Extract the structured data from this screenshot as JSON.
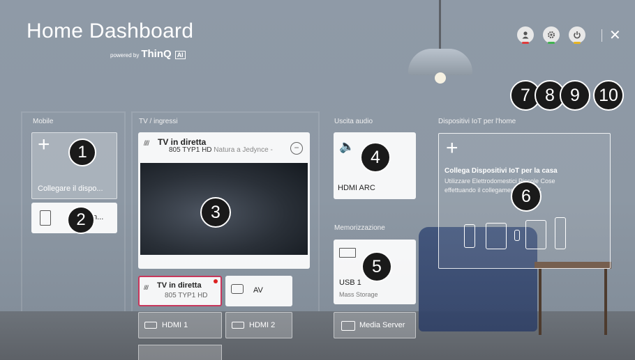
{
  "header": {
    "title": "Home Dashboard",
    "powered_by": "powered by",
    "brand": "ThinQ",
    "brand_badge": "AI"
  },
  "top_actions": [
    {
      "icon": "user-icon",
      "accent": "#e03c3c"
    },
    {
      "icon": "settings-icon",
      "accent": "#3fb34f"
    },
    {
      "icon": "power-icon",
      "accent": "#e6b422"
    },
    {
      "icon": "close-icon",
      "glyph": "✕"
    }
  ],
  "callouts": [
    "1",
    "2",
    "3",
    "4",
    "5",
    "6",
    "7",
    "8",
    "9",
    "10"
  ],
  "sections": {
    "mobile": "Mobile",
    "tv_inputs": "TV / ingressi",
    "audio_out": "Uscita audio",
    "storage": "Memorizzazione",
    "iot": "Dispositivi IoT per l'home"
  },
  "mobile_card": {
    "plus": "+",
    "label": "Collegare il dispo..."
  },
  "home_speaker_card": {
    "label": "n..."
  },
  "tv_card": {
    "antenna_glyph": "////",
    "channel_name": "TV in diretta",
    "channel_number": "805 TYP1 HD",
    "program": "Natura a Jedynce -",
    "minus": "−"
  },
  "tv_live_card": {
    "name": "TV in diretta",
    "number": "805 TYP1 HD"
  },
  "av_card": {
    "label": "AV"
  },
  "hdmi1": {
    "label": "HDMI 1"
  },
  "hdmi2": {
    "label": "HDMI 2"
  },
  "audio_card": {
    "speaker_glyph": "🔈",
    "label": "HDMI ARC"
  },
  "usb_card": {
    "name": "USB 1",
    "type": "Mass Storage"
  },
  "media_server": {
    "label": "Media Server"
  },
  "iot_card": {
    "plus": "+",
    "title": "Collega Dispositivi IoT per la casa",
    "desc": "Utilizzare Elettrodomestici Piccole Cose effettuando il collegamento alla TV."
  },
  "colors": {
    "selected_border": "#c8375c",
    "callout_bg": "#1a1a1a"
  }
}
